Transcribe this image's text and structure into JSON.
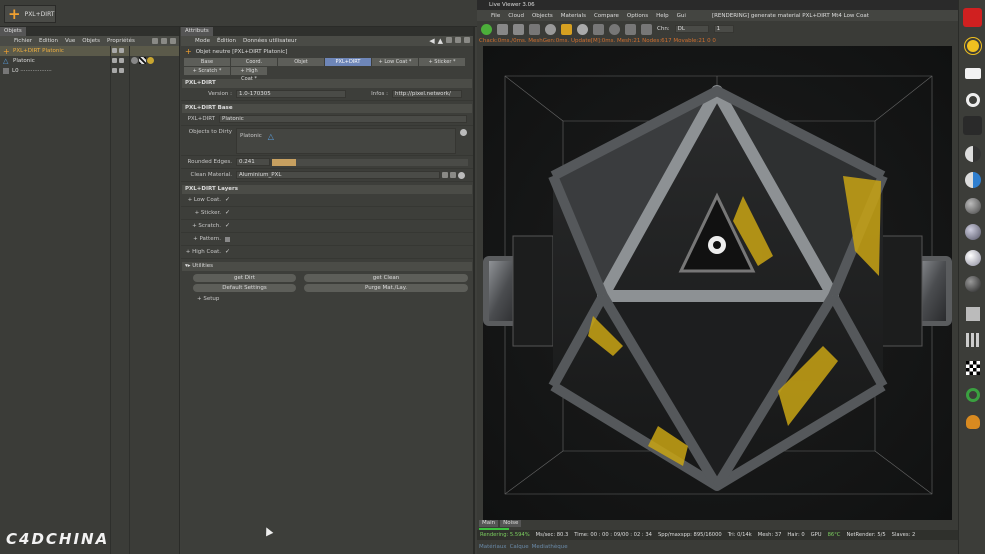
{
  "toolbar": {
    "plugin_button": "PXL+DIRT"
  },
  "object_manager": {
    "tab": "Objets",
    "menu": [
      "Fichier",
      "Edition",
      "Vue",
      "Objets",
      "Propriétés"
    ],
    "objects": [
      {
        "name": "PXL+DIRT Platonic",
        "selected": true
      },
      {
        "name": "Platonic",
        "selected": false
      },
      {
        "name": "L0 ··················",
        "selected": false
      }
    ]
  },
  "attributes": {
    "tab": "Attributs",
    "menu": [
      "Mode",
      "Édition",
      "Données utilisateur"
    ],
    "object_title": "Objet neutre [PXL+DIRT Platonic]",
    "tabs": [
      "Base",
      "Coord.",
      "Objet",
      "PXL+DIRT",
      "+ Low Coat *",
      "+ Sticker *",
      "+ Scratch *",
      "+ High Coat *"
    ],
    "active_tab": "PXL+DIRT",
    "sections": {
      "main": "PXL+DIRT",
      "base": "PXL+DIRT Base",
      "layers": "PXL+DIRT Layers",
      "utilities": "▾▸ Utilities"
    },
    "version_label": "Version :",
    "version_value": "1.0-170305",
    "infos_label": "Infos :",
    "infos_value": "http://pixel.network/",
    "pxl_label": "PXL+DIRT",
    "pxl_value": "Platonic",
    "objects_to_dirty_label": "Objects to Dirty",
    "objects_to_dirty_value": "Platonic",
    "rounded_label": "Rounded Edges.",
    "rounded_value": "0.241",
    "clean_material_label": "Clean Material.",
    "clean_material_value": "Aluminium_PXL",
    "layers": [
      {
        "label": "+ Low Coat.",
        "checked": true
      },
      {
        "label": "+ Sticker.",
        "checked": true
      },
      {
        "label": "+ Scratch.",
        "checked": true
      },
      {
        "label": "+ Pattern.",
        "checked": false
      },
      {
        "label": "+ High Coat.",
        "checked": true
      }
    ],
    "buttons": {
      "get_dirt": "get Dirt",
      "get_clean": "get Clean",
      "default_settings": "Default Settings",
      "purge": "Purge  Mat./Lay."
    },
    "setup": "+ Setup"
  },
  "live_viewer": {
    "title": "Live Viewer 3.06",
    "menu": [
      "File",
      "Cloud",
      "Objects",
      "Materials",
      "Compare",
      "Options",
      "Help",
      "Gui"
    ],
    "status": "[RENDERING] generate material PXL+DIRT Mt4 Low Coat",
    "channel_label": "Chn:",
    "channel_value": "DL",
    "channel_num": "1",
    "stats_line": "Chack:0ms./0ms. MeshGen:0ms. Update[M]:0ms. Mesh:21 Nodes:617 Movable:21  0 0",
    "view_tabs": [
      "Main",
      "Noise"
    ],
    "rendering_progress": 0.05594,
    "statusbar": {
      "rendering": "Rendering: 5.594%",
      "ms_sec": "Ms/sec: 80.3",
      "time": "Time: 00 : 00 : 09/00 : 02 : 34",
      "spp": "Spp/maxspp: 895/16000",
      "tri": "Tri: 0/14k",
      "mesh": "Mesh: 37",
      "hair": "Hair: 0",
      "gpu": "GPU",
      "temp": "86°C",
      "netrender": "NetRender: 5/5",
      "slaves": "Slaves: 2"
    },
    "bottom_tabs": [
      "Matériaux",
      "Calque",
      "Mediathèque"
    ]
  },
  "palette_icons": [
    "camera-icon",
    "daylight-icon",
    "area-light-icon",
    "target-light-icon",
    "ies-light-icon",
    "material-half-icon",
    "material-blue-icon",
    "sphere-gray-icon",
    "sphere-mid-icon",
    "sphere-light-icon",
    "sphere-dark-icon",
    "texture-icon",
    "grid-icon",
    "checker-icon",
    "recycle-icon",
    "tree-icon"
  ],
  "watermark": "C4DCHINA"
}
